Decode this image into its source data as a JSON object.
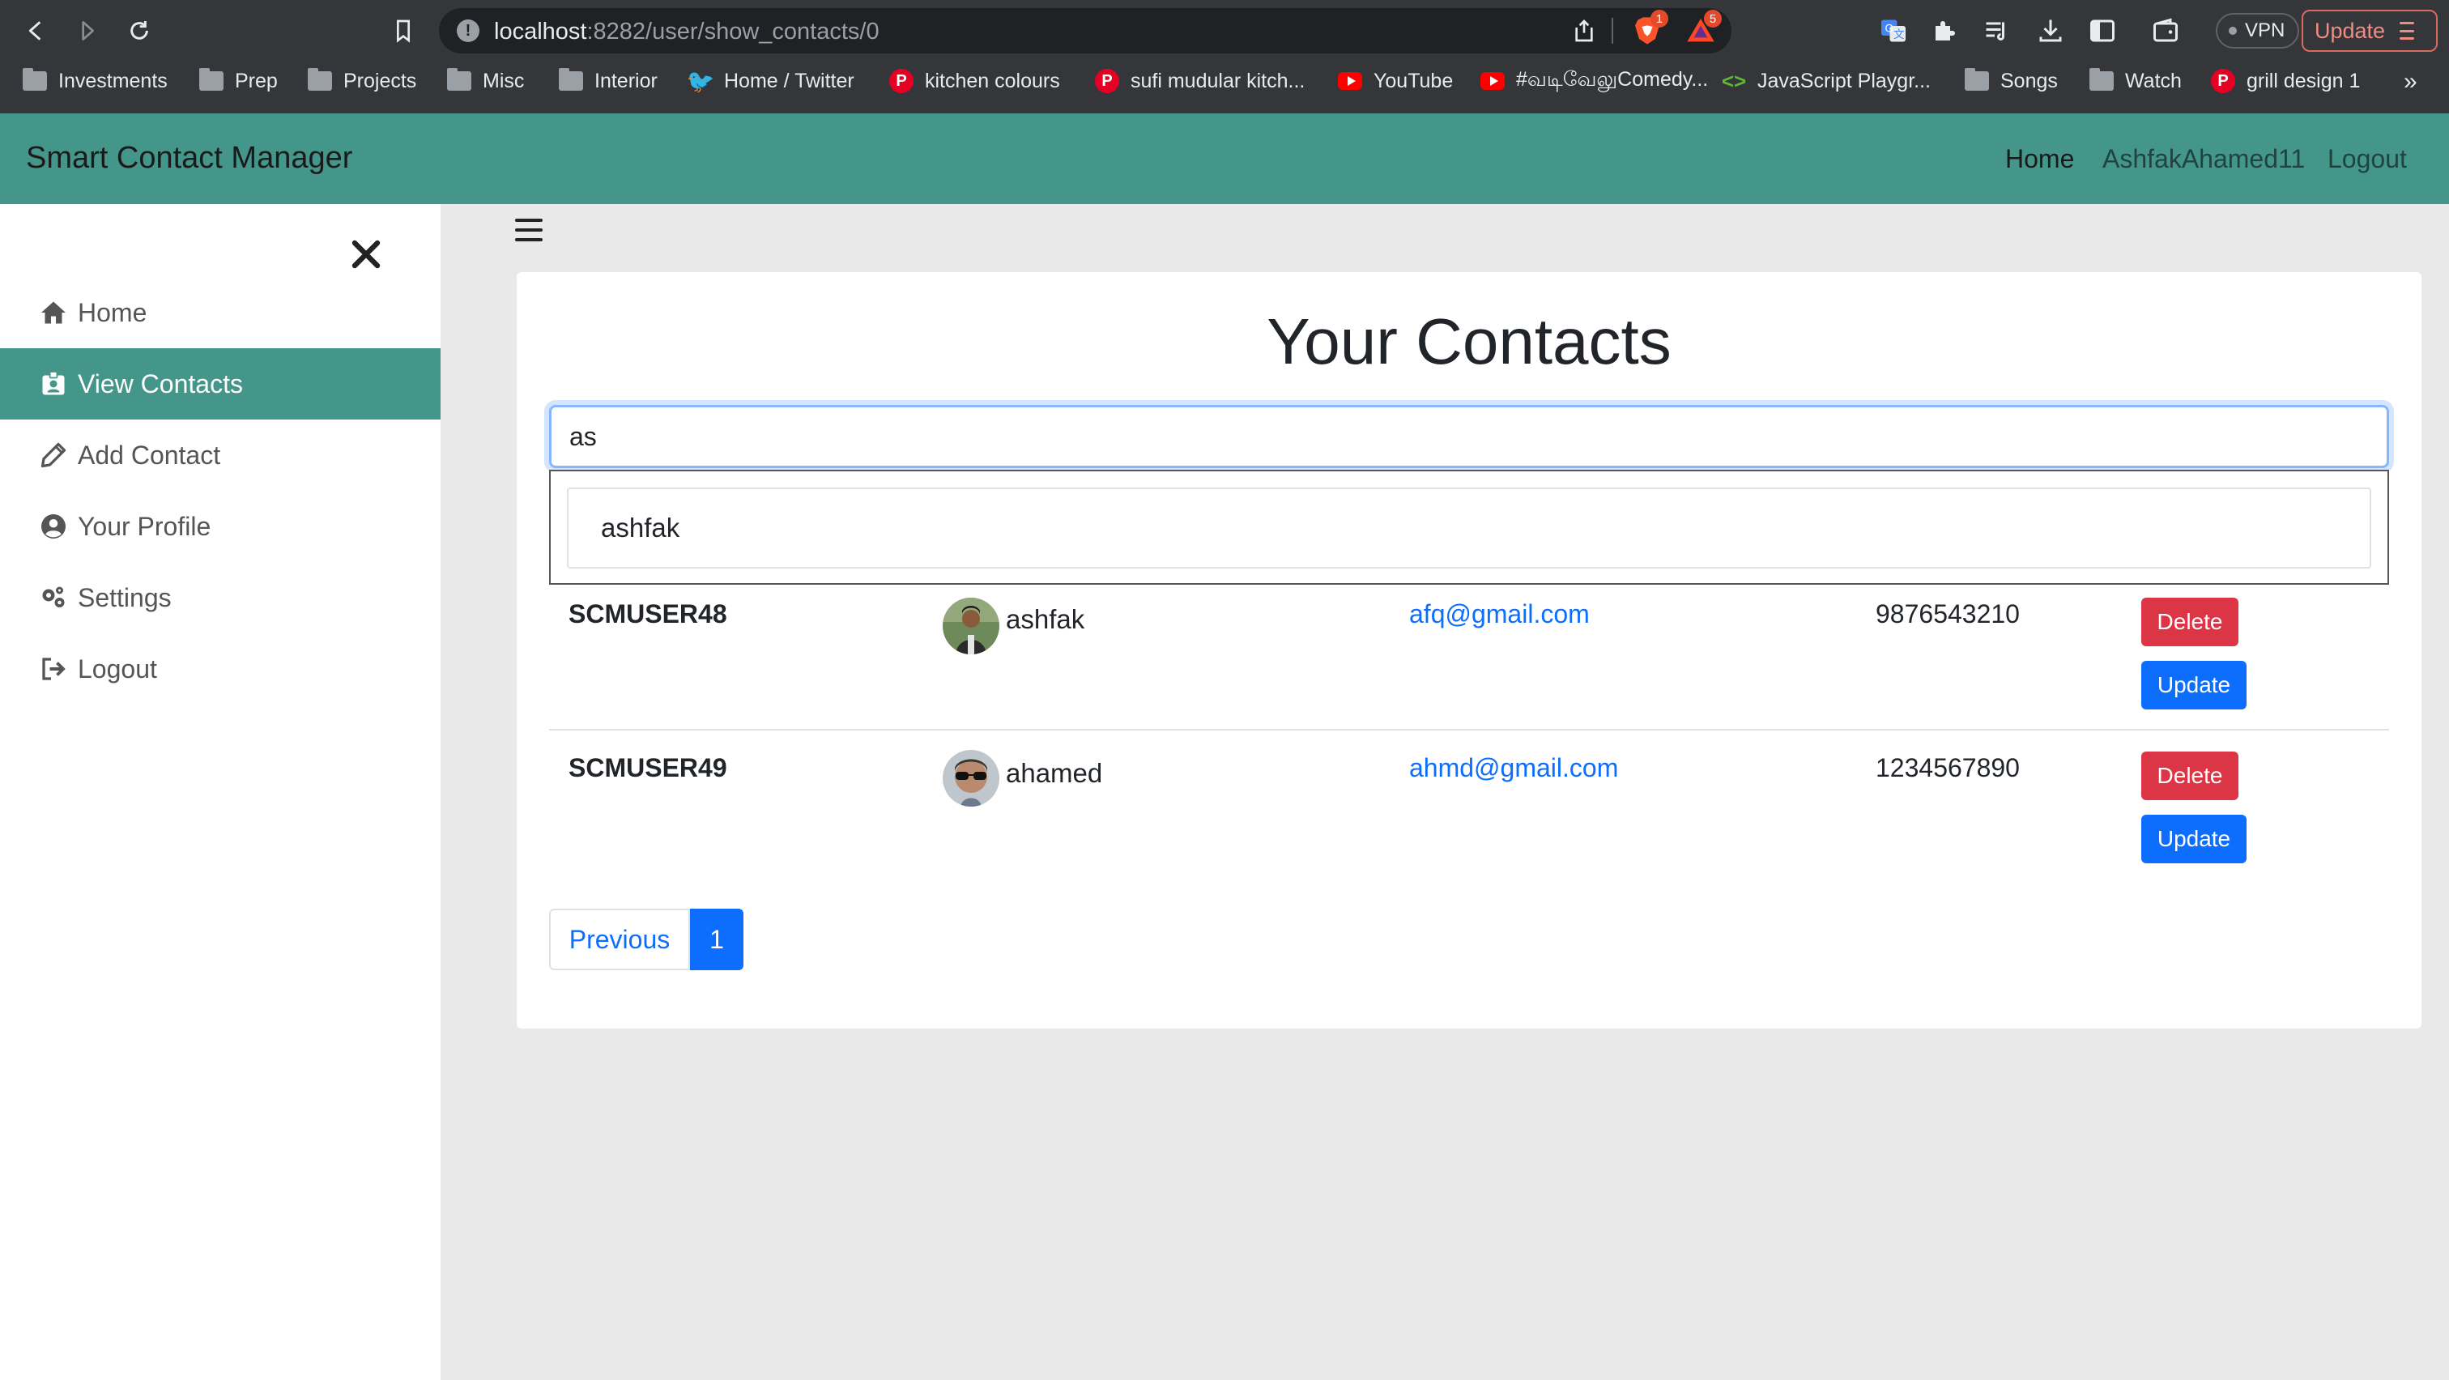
{
  "browser": {
    "url_host": "localhost",
    "url_path": ":8282/user/show_contacts/0",
    "brave_badge": "1",
    "rewards_badge": "5",
    "vpn_label": "VPN",
    "update_label": "Update",
    "bookmarks": [
      {
        "label": "Investments",
        "icon": "folder-icon"
      },
      {
        "label": "Prep",
        "icon": "folder-icon"
      },
      {
        "label": "Projects",
        "icon": "folder-icon"
      },
      {
        "label": "Misc",
        "icon": "folder-icon"
      },
      {
        "label": "Interior",
        "icon": "folder-icon"
      },
      {
        "label": "Home / Twitter",
        "icon": "twitter-icon"
      },
      {
        "label": "kitchen colours",
        "icon": "pinterest-icon"
      },
      {
        "label": "sufi mudular kitch...",
        "icon": "pinterest-icon"
      },
      {
        "label": "YouTube",
        "icon": "youtube-icon"
      },
      {
        "label": "#வடிவேலுComedy...",
        "icon": "youtube-icon"
      },
      {
        "label": "JavaScript Playgr...",
        "icon": "code-icon"
      },
      {
        "label": "Songs",
        "icon": "folder-icon"
      },
      {
        "label": "Watch",
        "icon": "folder-icon"
      },
      {
        "label": "grill design 1",
        "icon": "pinterest-icon"
      }
    ],
    "more_label": "»"
  },
  "navbar": {
    "brand": "Smart Contact Manager",
    "links": [
      "Home",
      "AshfakAhamed11",
      "Logout"
    ]
  },
  "sidebar": {
    "items": [
      {
        "label": "Home",
        "icon": "home-icon"
      },
      {
        "label": "View Contacts",
        "icon": "contact-card-icon"
      },
      {
        "label": "Add Contact",
        "icon": "pencil-icon"
      },
      {
        "label": "Your Profile",
        "icon": "user-circle-icon"
      },
      {
        "label": "Settings",
        "icon": "gears-icon"
      },
      {
        "label": "Logout",
        "icon": "sign-out-icon"
      }
    ]
  },
  "main": {
    "title": "Your Contacts",
    "search": {
      "value": "as"
    },
    "suggestions": [
      "ashfak"
    ],
    "contacts": [
      {
        "id": "SCMUSER48",
        "name": "ashfak",
        "email": "afq@gmail.com",
        "phone": "9876543210",
        "delete_label": "Delete",
        "update_label": "Update"
      },
      {
        "id": "SCMUSER49",
        "name": "ahamed",
        "email": "ahmd@gmail.com",
        "phone": "1234567890",
        "delete_label": "Delete",
        "update_label": "Update"
      }
    ],
    "pagination": {
      "previous_label": "Previous",
      "current_page": "1"
    }
  },
  "colors": {
    "brand": "#45968a",
    "primary": "#0d6efd",
    "danger": "#dc3545"
  }
}
